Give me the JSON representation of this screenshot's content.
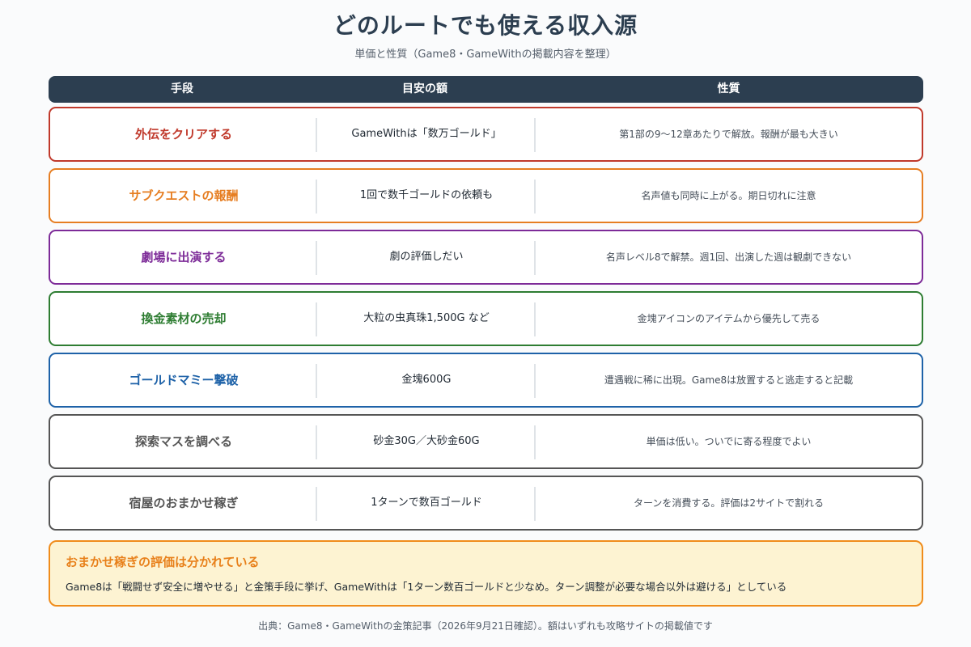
{
  "title": "どのルートでも使える収入源",
  "subtitle": "単価と性質（Game8・GameWithの掲載内容を整理）",
  "table": {
    "headers": [
      "手段",
      "目安の額",
      "性質"
    ],
    "rows": [
      {
        "method": "外伝をクリアする",
        "amount": "GameWithは「数万ゴールド」",
        "note": "第1部の9〜12章あたりで解放。報酬が最も大きい",
        "color": "#c0392b"
      },
      {
        "method": "サブクエストの報酬",
        "amount": "1回で数千ゴールドの依頼も",
        "note": "名声値も同時に上がる。期日切れに注意",
        "color": "#e67e22"
      },
      {
        "method": "劇場に出演する",
        "amount": "劇の評価しだい",
        "note": "名声レベル8で解禁。週1回、出演した週は観劇できない",
        "color": "#7d2b98"
      },
      {
        "method": "換金素材の売却",
        "amount": "大粒の虫真珠1,500G など",
        "note": "金塊アイコンのアイテムから優先して売る",
        "color": "#2e7d32"
      },
      {
        "method": "ゴールドマミー撃破",
        "amount": "金塊600G",
        "note": "遭遇戦に稀に出現。Game8は放置すると逃走すると記載",
        "color": "#1e62a8"
      },
      {
        "method": "探索マスを調べる",
        "amount": "砂金30G／大砂金60G",
        "note": "単価は低い。ついでに寄る程度でよい",
        "color": "#555555"
      },
      {
        "method": "宿屋のおまかせ稼ぎ",
        "amount": "1ターンで数百ゴールド",
        "note": "ターンを消費する。評価は2サイトで割れる",
        "color": "#555555"
      }
    ]
  },
  "callout": {
    "title": "おまかせ稼ぎの評価は分かれている",
    "body": "Game8は「戦闘せず安全に増やせる」と金策手段に挙げ、GameWithは「1ターン数百ゴールドと少なめ。ターン調整が必要な場合以外は避ける」としている"
  },
  "footer": "出典：Game8・GameWithの金策記事（2026年9月21日確認）。額はいずれも攻略サイトの掲載値です"
}
